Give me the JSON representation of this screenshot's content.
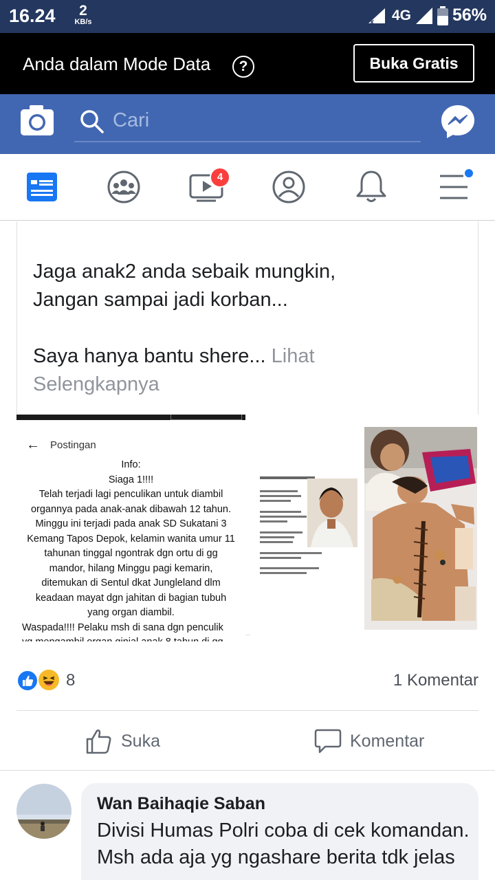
{
  "status_bar": {
    "time": "16.24",
    "speed_value": "2",
    "speed_unit": "KB/s",
    "network": "4G",
    "battery": "56%"
  },
  "data_mode": {
    "text": "Anda dalam Mode Data",
    "help_glyph": "?",
    "button": "Buka Gratis"
  },
  "header": {
    "search_placeholder": "Cari",
    "brand_color": "#4267b2"
  },
  "nav": {
    "video_badge": "4",
    "items": [
      "news-feed-icon",
      "groups-icon",
      "watch-icon",
      "profile-icon",
      "notifications-icon",
      "menu-icon"
    ]
  },
  "post": {
    "lines": [
      "Jaga anak2 anda sebaik mungkin,",
      "Jangan sampai jadi korban...",
      "Saya hanya bantu shere..."
    ],
    "see_more_1": "Lihat",
    "see_more_2": "Selengkapnya",
    "screenshot": {
      "back_glyph": "←",
      "title": "Postingan",
      "body": [
        "Info:",
        "Siaga 1!!!!",
        "Telah terjadi lagi penculikan untuk diambil",
        "organnya pada anak-anak dibawah 12 tahun.",
        "Minggu ini terjadi pada anak SD Sukatani 3",
        "Kemang Tapos Depok, kelamin wanita umur 11",
        "tahunan tinggal ngontrak dgn ortu di gg",
        "mandor, hilang Minggu pagi kemarin,",
        "ditemukan di Sentul dkat Jungleland dlm",
        "keadaan mayat dgn jahitan di bagian tubuh",
        "yang organ diambil.",
        "Waspada!!!! Pelaku msh di sana dgn penculik",
        "yg mengambil organ ginjal anak 8 tahun di gg"
      ]
    },
    "reaction_count": "8",
    "comment_count": "1 Komentar",
    "like_label": "Suka",
    "comment_label": "Komentar"
  },
  "comment": {
    "author": "Wan Baihaqie Saban",
    "text": "Divisi Humas Polri coba di cek komandan. Msh ada aja yg ngashare berita tdk jelas"
  }
}
